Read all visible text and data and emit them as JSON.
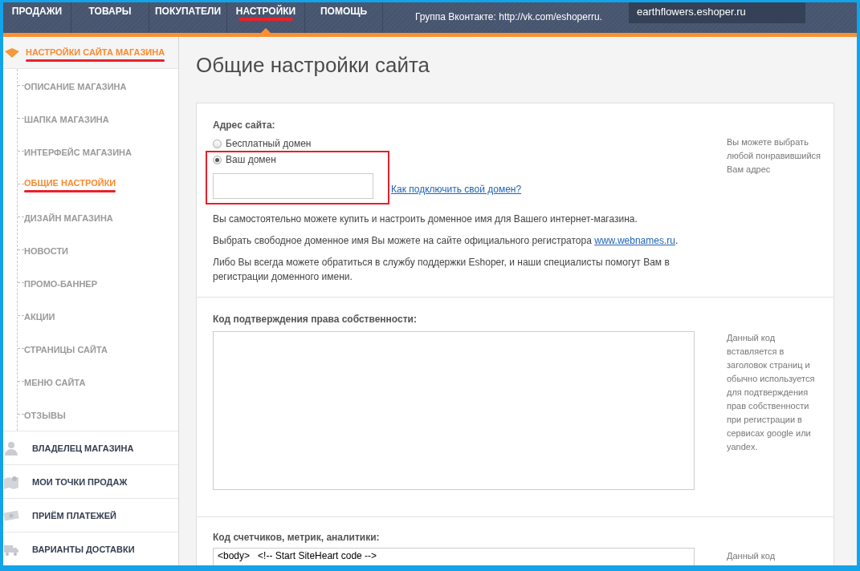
{
  "nav": {
    "tabs": [
      {
        "label": "ПРОДАЖИ",
        "selected": false
      },
      {
        "label": "ТОВАРЫ",
        "selected": false
      },
      {
        "label": "ПОКУПАТЕЛИ",
        "selected": false
      },
      {
        "label": "НАСТРОЙКИ",
        "selected": true
      },
      {
        "label": "ПОМОЩЬ",
        "selected": false
      }
    ],
    "info_text": "Группа Вконтакте:",
    "info_link": "http://vk.com/eshoperru",
    "info_suffix": ".",
    "store_link": "earthflowers.eshoper.ru"
  },
  "sidebar": {
    "section": {
      "label": "НАСТРОЙКИ САЙТА МАГАЗИНА",
      "expanded": true,
      "highlighted": true,
      "children": [
        {
          "label": "ОПИСАНИЕ МАГАЗИНА",
          "selected": false
        },
        {
          "label": "ШАПКА МАГАЗИНА",
          "selected": false
        },
        {
          "label": "ИНТЕРФЕЙС МАГАЗИНА",
          "selected": false
        },
        {
          "label": "ОБЩИЕ НАСТРОЙКИ",
          "selected": true
        },
        {
          "label": "ДИЗАЙН МАГАЗИНА",
          "selected": false
        },
        {
          "label": "НОВОСТИ",
          "selected": false
        },
        {
          "label": "ПРОМО-БАННЕР",
          "selected": false
        },
        {
          "label": "АКЦИИ",
          "selected": false
        },
        {
          "label": "СТРАНИЦЫ САЙТА",
          "selected": false
        },
        {
          "label": "МЕНЮ САЙТА",
          "selected": false
        },
        {
          "label": "ОТЗЫВЫ",
          "selected": false
        }
      ]
    },
    "items": [
      {
        "label": "ВЛАДЕЛЕЦ МАГАЗИНА",
        "kind": "person"
      },
      {
        "label": "МОИ ТОЧКИ ПРОДАЖ",
        "kind": "map"
      },
      {
        "label": "ПРИЁМ ПЛАТЕЖЕЙ",
        "kind": "money"
      },
      {
        "label": "ВАРИАНТЫ ДОСТАВКИ",
        "kind": "truck"
      }
    ]
  },
  "page_title": "Общие настройки сайта",
  "domain_section": {
    "label": "Адрес сайта:",
    "options": [
      {
        "label": "Бесплатный домен",
        "selected": false
      },
      {
        "label": "Ваш домен",
        "selected": true
      }
    ],
    "highlighted": true,
    "help_link": "Как подключить свой домен?",
    "paragraphs": [
      {
        "text": "Вы самостоятельно можете купить и настроить доменное имя для Вашего интернет-магазина."
      },
      {
        "text": "Выбрать свободное доменное имя Вы можете на сайте официального регистратора",
        "link": "www.webnames.ru",
        "suffix": "."
      },
      {
        "text": "Либо Вы всегда можете обратиться в службу поддержки Eshoper, и наши специалисты помогут Вам в регистрации доменного имени."
      }
    ],
    "hint": "Вы можете выбрать любой понравившийся Вам адрес"
  },
  "ownership_section": {
    "label": "Код подтверждения права собственности:",
    "hint": "Данный код вставляется в заголовок страниц и обычно используется для подтверждения прав собственности при регистрации в сервисах google или yandex."
  },
  "counters_section": {
    "label": "Код счетчиков, метрик, аналитики:",
    "code": "<body>   <!-- Start SiteHeart code -->",
    "hint": "Данный код"
  }
}
